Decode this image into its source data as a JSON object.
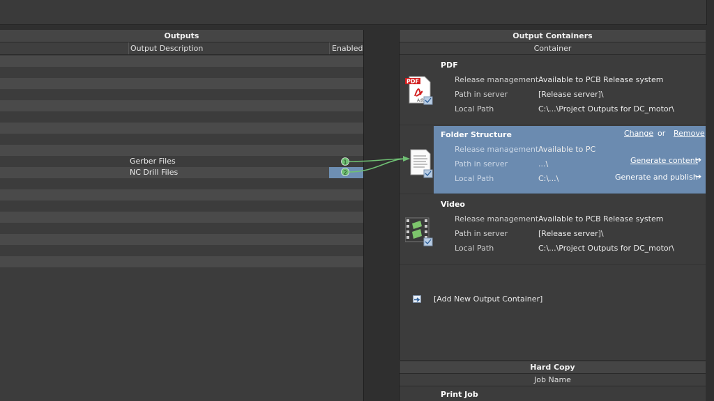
{
  "outputs": {
    "title": "Outputs",
    "col_description": "Output Description",
    "col_enabled": "Enabled",
    "rows": [
      "",
      "",
      "",
      "",
      "",
      "",
      "",
      "",
      "",
      "Gerber Files",
      "NC Drill Files",
      "",
      "",
      "",
      "",
      "",
      "",
      "",
      "",
      ""
    ]
  },
  "markers": {
    "m1": "1",
    "m2": "2"
  },
  "containers": {
    "title": "Output Containers",
    "col_container": "Container",
    "items": [
      {
        "name": "PDF",
        "release_label": "Release management",
        "release_value": "Available to PCB Release system",
        "path_label": "Path in server",
        "path_value": "[Release server]\\",
        "local_label": "Local Path",
        "local_value": "C:\\...\\Project Outputs for DC_motor\\"
      },
      {
        "name": "Folder Structure",
        "release_label": "Release management",
        "release_value": "Available to PC",
        "path_label": "Path in server",
        "path_value": "...\\",
        "local_label": "Local Path",
        "local_value": "C:\\...\\",
        "change": "Change",
        "or": "or",
        "remove": "Remove",
        "generate": "Generate content",
        "publish": "Generate and publish"
      },
      {
        "name": "Video",
        "release_label": "Release management",
        "release_value": "Available to PCB Release system",
        "path_label": "Path in server",
        "path_value": "[Release server]\\",
        "local_label": "Local Path",
        "local_value": "C:\\...\\Project Outputs for DC_motor\\"
      }
    ],
    "add_label": "[Add New Output Container]"
  },
  "hardcopy": {
    "title": "Hard Copy",
    "col_job": "Job Name",
    "job": "Print Job"
  },
  "icons": {
    "pdf": "pdf-file-icon",
    "folder": "document-list-icon",
    "video": "video-file-icon",
    "add": "add-container-icon"
  },
  "colors": {
    "selection": "#6b8bb0",
    "wire": "#6fbf73"
  }
}
